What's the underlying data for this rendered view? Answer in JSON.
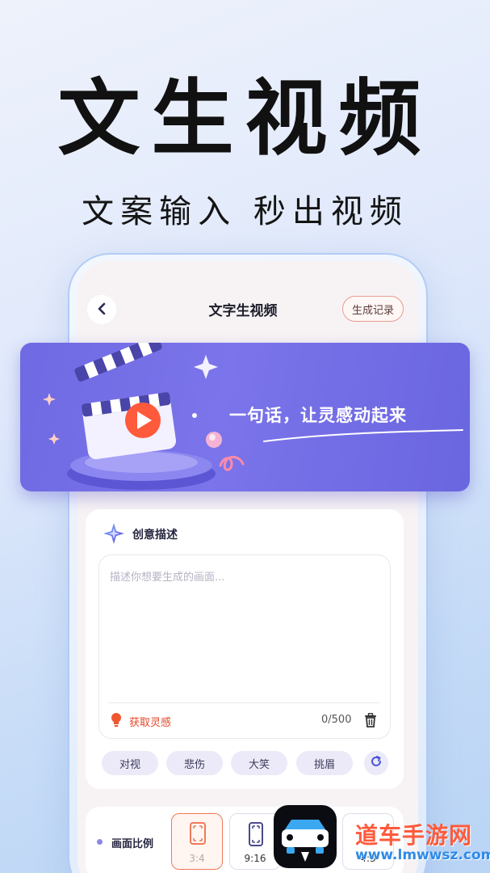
{
  "hero": {
    "title": "文生视频",
    "subtitle": "文案输入 秒出视频"
  },
  "header": {
    "back_icon": "chevron-left-icon",
    "title": "文字生视频",
    "history_label": "生成记录"
  },
  "banner": {
    "slogan": "一句话，让灵感动起来",
    "illustration": "clapperboard-icon"
  },
  "creative": {
    "section_icon": "sparkle-icon",
    "section_title": "创意描述",
    "placeholder": "描述你想要生成的画面...",
    "inspire_icon": "lightbulb-icon",
    "inspire_label": "获取灵感",
    "counter": "0/500",
    "delete_icon": "trash-icon",
    "chips": [
      "对视",
      "悲伤",
      "大笑",
      "挑眉"
    ],
    "refresh_icon": "refresh-icon"
  },
  "ratio": {
    "label": "画面比例",
    "options": [
      {
        "label": "3:4",
        "selected": true
      },
      {
        "label": "9:16",
        "selected": false
      },
      {
        "label": "4:3",
        "selected": false
      }
    ]
  },
  "watermark": {
    "site_name": "道车手游网",
    "site_url": "www.lmwwsz.com"
  },
  "colors": {
    "accent": "#6f6ae3",
    "inspire": "#e2482a",
    "selected_border": "#ef7a5a"
  }
}
